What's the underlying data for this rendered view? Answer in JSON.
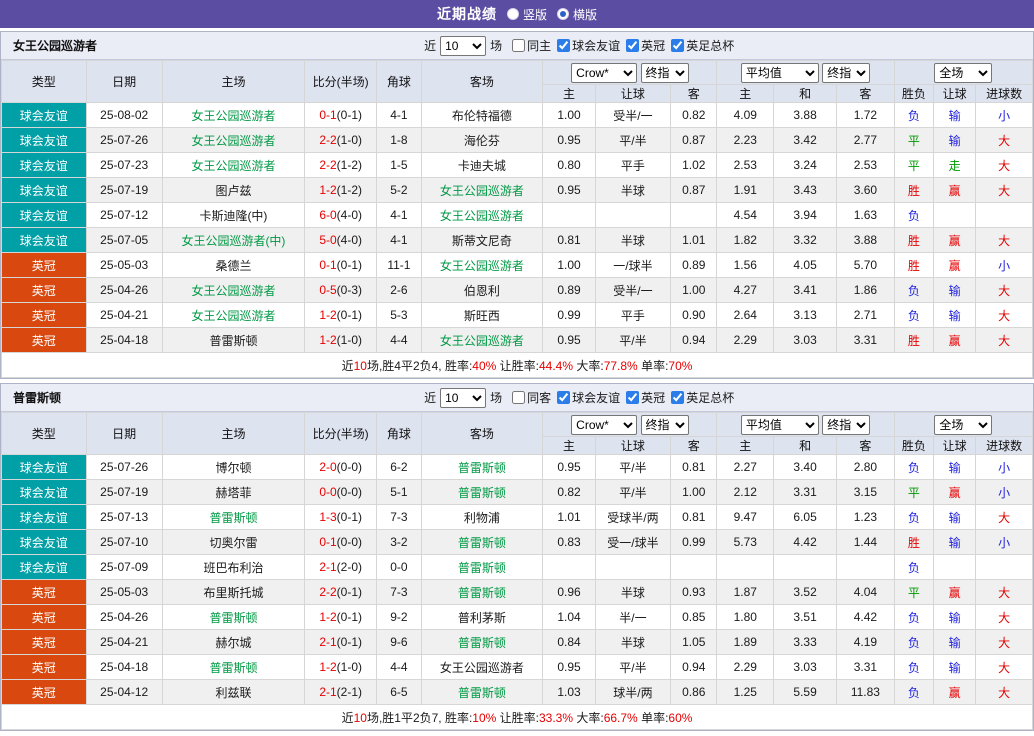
{
  "topbar": {
    "title": "近期战绩",
    "radios": [
      {
        "label": "竖版",
        "selected": false
      },
      {
        "label": "横版",
        "selected": true
      }
    ]
  },
  "filter": {
    "prefix": "近",
    "count": "10",
    "suffix": "场"
  },
  "columns": {
    "main": [
      "类型",
      "日期",
      "主场",
      "比分(半场)",
      "角球",
      "客场"
    ],
    "dd": [
      "Crow*",
      "终指",
      "平均值",
      "终指",
      "全场"
    ],
    "sub": [
      "主",
      "让球",
      "客",
      "主",
      "和",
      "客",
      "胜负",
      "让球",
      "进球数"
    ]
  },
  "colors": {
    "accent_purple": "#5a4da2",
    "badge_friendly": "#00a0a6",
    "badge_cup": "#d9480f",
    "team_green": "#009944",
    "win_red": "#e60000",
    "lose_blue": "#2222dd",
    "draw_green": "#009900",
    "odds_col_bg": "#fdf8f0",
    "avg_col_bg": "#e9f4fb"
  },
  "sections": [
    {
      "team": "女王公园巡游者",
      "filters": [
        {
          "label": "同主",
          "checked": false
        },
        {
          "label": "球会友谊",
          "checked": true
        },
        {
          "label": "英冠",
          "checked": true
        },
        {
          "label": "英足总杯",
          "checked": true
        }
      ],
      "rows": [
        {
          "type": "球会友谊",
          "date": "25-08-02",
          "home": "女王公园巡游者",
          "hh": true,
          "score": "0-1",
          "half": "(0-1)",
          "corner": "4-1",
          "away": "布伦特福德",
          "ah": false,
          "o1": "1.00",
          "hc": "受半/一",
          "o2": "0.82",
          "a1": "4.09",
          "a2": "3.88",
          "a3": "1.72",
          "r1": {
            "t": "负",
            "c": "b"
          },
          "r2": {
            "t": "输",
            "c": "b"
          },
          "r3": {
            "t": "小",
            "c": "b"
          }
        },
        {
          "type": "球会友谊",
          "date": "25-07-26",
          "home": "女王公园巡游者",
          "hh": true,
          "score": "2-2",
          "half": "(1-0)",
          "corner": "1-8",
          "away": "海伦芬",
          "ah": false,
          "o1": "0.95",
          "hc": "平/半",
          "o2": "0.87",
          "a1": "2.23",
          "a2": "3.42",
          "a3": "2.77",
          "r1": {
            "t": "平",
            "c": "g"
          },
          "r2": {
            "t": "输",
            "c": "b"
          },
          "r3": {
            "t": "大",
            "c": "r"
          }
        },
        {
          "type": "球会友谊",
          "date": "25-07-23",
          "home": "女王公园巡游者",
          "hh": true,
          "score": "2-2",
          "half": "(1-2)",
          "corner": "1-5",
          "away": "卡迪夫城",
          "ah": false,
          "o1": "0.80",
          "hc": "平手",
          "o2": "1.02",
          "a1": "2.53",
          "a2": "3.24",
          "a3": "2.53",
          "r1": {
            "t": "平",
            "c": "g"
          },
          "r2": {
            "t": "走",
            "c": "g"
          },
          "r3": {
            "t": "大",
            "c": "r"
          }
        },
        {
          "type": "球会友谊",
          "date": "25-07-19",
          "home": "图卢兹",
          "hh": false,
          "score": "1-2",
          "half": "(1-2)",
          "corner": "5-2",
          "away": "女王公园巡游者",
          "ah": true,
          "o1": "0.95",
          "hc": "半球",
          "o2": "0.87",
          "a1": "1.91",
          "a2": "3.43",
          "a3": "3.60",
          "r1": {
            "t": "胜",
            "c": "r"
          },
          "r2": {
            "t": "赢",
            "c": "r"
          },
          "r3": {
            "t": "大",
            "c": "r"
          }
        },
        {
          "type": "球会友谊",
          "date": "25-07-12",
          "home": "卡斯迪隆(中)",
          "hh": false,
          "score": "6-0",
          "half": "(4-0)",
          "corner": "4-1",
          "away": "女王公园巡游者",
          "ah": true,
          "o1": "",
          "hc": "",
          "o2": "",
          "a1": "4.54",
          "a2": "3.94",
          "a3": "1.63",
          "r1": {
            "t": "负",
            "c": "b"
          },
          "r2": {
            "t": "",
            "c": "b"
          },
          "r3": {
            "t": "",
            "c": "b"
          }
        },
        {
          "type": "球会友谊",
          "date": "25-07-05",
          "home": "女王公园巡游者(中)",
          "hh": true,
          "score": "5-0",
          "half": "(4-0)",
          "corner": "4-1",
          "away": "斯蒂文尼奇",
          "ah": false,
          "o1": "0.81",
          "hc": "半球",
          "o2": "1.01",
          "a1": "1.82",
          "a2": "3.32",
          "a3": "3.88",
          "r1": {
            "t": "胜",
            "c": "r"
          },
          "r2": {
            "t": "赢",
            "c": "r"
          },
          "r3": {
            "t": "大",
            "c": "r"
          }
        },
        {
          "type": "英冠",
          "date": "25-05-03",
          "home": "桑德兰",
          "hh": false,
          "score": "0-1",
          "half": "(0-1)",
          "corner": "11-1",
          "away": "女王公园巡游者",
          "ah": true,
          "o1": "1.00",
          "hc": "一/球半",
          "o2": "0.89",
          "a1": "1.56",
          "a2": "4.05",
          "a3": "5.70",
          "r1": {
            "t": "胜",
            "c": "r"
          },
          "r2": {
            "t": "赢",
            "c": "r"
          },
          "r3": {
            "t": "小",
            "c": "b"
          }
        },
        {
          "type": "英冠",
          "date": "25-04-26",
          "home": "女王公园巡游者",
          "hh": true,
          "score": "0-5",
          "half": "(0-3)",
          "corner": "2-6",
          "away": "伯恩利",
          "ah": false,
          "o1": "0.89",
          "hc": "受半/一",
          "o2": "1.00",
          "a1": "4.27",
          "a2": "3.41",
          "a3": "1.86",
          "r1": {
            "t": "负",
            "c": "b"
          },
          "r2": {
            "t": "输",
            "c": "b"
          },
          "r3": {
            "t": "大",
            "c": "r"
          }
        },
        {
          "type": "英冠",
          "date": "25-04-21",
          "home": "女王公园巡游者",
          "hh": true,
          "score": "1-2",
          "half": "(0-1)",
          "corner": "5-3",
          "away": "斯旺西",
          "ah": false,
          "o1": "0.99",
          "hc": "平手",
          "o2": "0.90",
          "a1": "2.64",
          "a2": "3.13",
          "a3": "2.71",
          "r1": {
            "t": "负",
            "c": "b"
          },
          "r2": {
            "t": "输",
            "c": "b"
          },
          "r3": {
            "t": "大",
            "c": "r"
          }
        },
        {
          "type": "英冠",
          "date": "25-04-18",
          "home": "普雷斯顿",
          "hh": false,
          "score": "1-2",
          "half": "(1-0)",
          "corner": "4-4",
          "away": "女王公园巡游者",
          "ah": true,
          "o1": "0.95",
          "hc": "平/半",
          "o2": "0.94",
          "a1": "2.29",
          "a2": "3.03",
          "a3": "3.31",
          "r1": {
            "t": "胜",
            "c": "r"
          },
          "r2": {
            "t": "赢",
            "c": "r"
          },
          "r3": {
            "t": "大",
            "c": "r"
          }
        }
      ],
      "summary": [
        {
          "t": "近",
          "red": false
        },
        {
          "t": "10",
          "red": true
        },
        {
          "t": "场,胜4平2负4, 胜率:",
          "red": false
        },
        {
          "t": "40%",
          "red": true
        },
        {
          "t": " 让胜率:",
          "red": false
        },
        {
          "t": "44.4%",
          "red": true
        },
        {
          "t": " 大率:",
          "red": false
        },
        {
          "t": "77.8%",
          "red": true
        },
        {
          "t": " 单率:",
          "red": false
        },
        {
          "t": "70%",
          "red": true
        }
      ]
    },
    {
      "team": "普雷斯顿",
      "filters": [
        {
          "label": "同客",
          "checked": false
        },
        {
          "label": "球会友谊",
          "checked": true
        },
        {
          "label": "英冠",
          "checked": true
        },
        {
          "label": "英足总杯",
          "checked": true
        }
      ],
      "rows": [
        {
          "type": "球会友谊",
          "date": "25-07-26",
          "home": "博尔顿",
          "hh": false,
          "score": "2-0",
          "half": "(0-0)",
          "corner": "6-2",
          "away": "普雷斯顿",
          "ah": true,
          "o1": "0.95",
          "hc": "平/半",
          "o2": "0.81",
          "a1": "2.27",
          "a2": "3.40",
          "a3": "2.80",
          "r1": {
            "t": "负",
            "c": "b"
          },
          "r2": {
            "t": "输",
            "c": "b"
          },
          "r3": {
            "t": "小",
            "c": "b"
          }
        },
        {
          "type": "球会友谊",
          "date": "25-07-19",
          "home": "赫塔菲",
          "hh": false,
          "score": "0-0",
          "half": "(0-0)",
          "corner": "5-1",
          "away": "普雷斯顿",
          "ah": true,
          "o1": "0.82",
          "hc": "平/半",
          "o2": "1.00",
          "a1": "2.12",
          "a2": "3.31",
          "a3": "3.15",
          "r1": {
            "t": "平",
            "c": "g"
          },
          "r2": {
            "t": "赢",
            "c": "r"
          },
          "r3": {
            "t": "小",
            "c": "b"
          }
        },
        {
          "type": "球会友谊",
          "date": "25-07-13",
          "home": "普雷斯顿",
          "hh": true,
          "score": "1-3",
          "half": "(0-1)",
          "corner": "7-3",
          "away": "利物浦",
          "ah": false,
          "o1": "1.01",
          "hc": "受球半/两",
          "o2": "0.81",
          "a1": "9.47",
          "a2": "6.05",
          "a3": "1.23",
          "r1": {
            "t": "负",
            "c": "b"
          },
          "r2": {
            "t": "输",
            "c": "b"
          },
          "r3": {
            "t": "大",
            "c": "r"
          }
        },
        {
          "type": "球会友谊",
          "date": "25-07-10",
          "home": "切奥尔雷",
          "hh": false,
          "score": "0-1",
          "half": "(0-0)",
          "corner": "3-2",
          "away": "普雷斯顿",
          "ah": true,
          "o1": "0.83",
          "hc": "受一/球半",
          "o2": "0.99",
          "a1": "5.73",
          "a2": "4.42",
          "a3": "1.44",
          "r1": {
            "t": "胜",
            "c": "r"
          },
          "r2": {
            "t": "输",
            "c": "b"
          },
          "r3": {
            "t": "小",
            "c": "b"
          }
        },
        {
          "type": "球会友谊",
          "date": "25-07-09",
          "home": "班巴布利治",
          "hh": false,
          "score": "2-1",
          "half": "(2-0)",
          "corner": "0-0",
          "away": "普雷斯顿",
          "ah": true,
          "o1": "",
          "hc": "",
          "o2": "",
          "a1": "",
          "a2": "",
          "a3": "",
          "r1": {
            "t": "负",
            "c": "b"
          },
          "r2": {
            "t": "",
            "c": "b"
          },
          "r3": {
            "t": "",
            "c": "b"
          }
        },
        {
          "type": "英冠",
          "date": "25-05-03",
          "home": "布里斯托城",
          "hh": false,
          "score": "2-2",
          "half": "(0-1)",
          "corner": "7-3",
          "away": "普雷斯顿",
          "ah": true,
          "o1": "0.96",
          "hc": "半球",
          "o2": "0.93",
          "a1": "1.87",
          "a2": "3.52",
          "a3": "4.04",
          "r1": {
            "t": "平",
            "c": "g"
          },
          "r2": {
            "t": "赢",
            "c": "r"
          },
          "r3": {
            "t": "大",
            "c": "r"
          }
        },
        {
          "type": "英冠",
          "date": "25-04-26",
          "home": "普雷斯顿",
          "hh": true,
          "score": "1-2",
          "half": "(0-1)",
          "corner": "9-2",
          "away": "普利茅斯",
          "ah": false,
          "o1": "1.04",
          "hc": "半/一",
          "o2": "0.85",
          "a1": "1.80",
          "a2": "3.51",
          "a3": "4.42",
          "r1": {
            "t": "负",
            "c": "b"
          },
          "r2": {
            "t": "输",
            "c": "b"
          },
          "r3": {
            "t": "大",
            "c": "r"
          }
        },
        {
          "type": "英冠",
          "date": "25-04-21",
          "home": "赫尔城",
          "hh": false,
          "score": "2-1",
          "half": "(0-1)",
          "corner": "9-6",
          "away": "普雷斯顿",
          "ah": true,
          "o1": "0.84",
          "hc": "半球",
          "o2": "1.05",
          "a1": "1.89",
          "a2": "3.33",
          "a3": "4.19",
          "r1": {
            "t": "负",
            "c": "b"
          },
          "r2": {
            "t": "输",
            "c": "b"
          },
          "r3": {
            "t": "大",
            "c": "r"
          }
        },
        {
          "type": "英冠",
          "date": "25-04-18",
          "home": "普雷斯顿",
          "hh": true,
          "score": "1-2",
          "half": "(1-0)",
          "corner": "4-4",
          "away": "女王公园巡游者",
          "ah": false,
          "o1": "0.95",
          "hc": "平/半",
          "o2": "0.94",
          "a1": "2.29",
          "a2": "3.03",
          "a3": "3.31",
          "r1": {
            "t": "负",
            "c": "b"
          },
          "r2": {
            "t": "输",
            "c": "b"
          },
          "r3": {
            "t": "大",
            "c": "r"
          }
        },
        {
          "type": "英冠",
          "date": "25-04-12",
          "home": "利兹联",
          "hh": false,
          "score": "2-1",
          "half": "(2-1)",
          "corner": "6-5",
          "away": "普雷斯顿",
          "ah": true,
          "o1": "1.03",
          "hc": "球半/两",
          "o2": "0.86",
          "a1": "1.25",
          "a2": "5.59",
          "a3": "11.83",
          "r1": {
            "t": "负",
            "c": "b"
          },
          "r2": {
            "t": "赢",
            "c": "r"
          },
          "r3": {
            "t": "大",
            "c": "r"
          }
        }
      ],
      "summary": [
        {
          "t": "近",
          "red": false
        },
        {
          "t": "10",
          "red": true
        },
        {
          "t": "场,胜1平2负7, 胜率:",
          "red": false
        },
        {
          "t": "10%",
          "red": true
        },
        {
          "t": " 让胜率:",
          "red": false
        },
        {
          "t": "33.3%",
          "red": true
        },
        {
          "t": " 大率:",
          "red": false
        },
        {
          "t": "66.7%",
          "red": true
        },
        {
          "t": " 单率:",
          "red": false
        },
        {
          "t": "60%",
          "red": true
        }
      ]
    }
  ]
}
